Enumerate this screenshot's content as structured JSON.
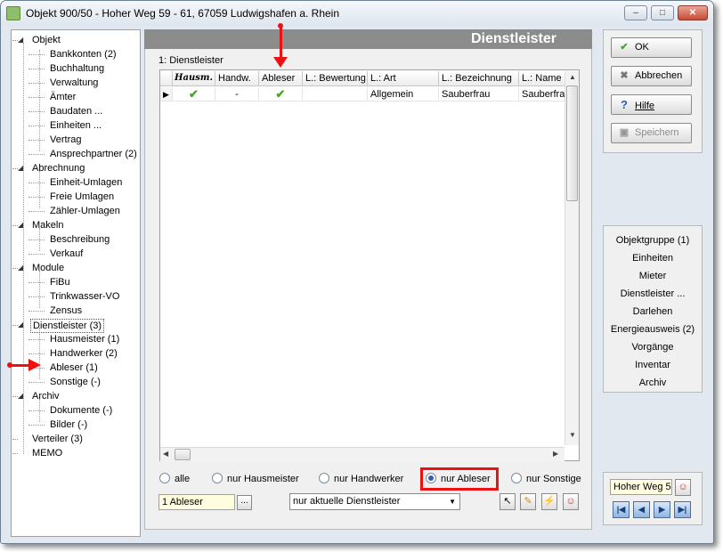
{
  "window": {
    "title": "Objekt 900/50 - Hoher Weg 59 - 61, 67059 Ludwigshafen a. Rhein",
    "min": "‒",
    "max": "□",
    "close": "✕"
  },
  "tree": {
    "objekt": "Objekt",
    "bankkonten": "Bankkonten (2)",
    "buchhaltung": "Buchhaltung",
    "verwaltung": "Verwaltung",
    "aemter": "Ämter",
    "baudaten": "Baudaten ...",
    "einheiten": "Einheiten ...",
    "vertrag": "Vertrag",
    "ansprechpartner": "Ansprechpartner (2)",
    "abrechnung": "Abrechnung",
    "einheit_umlagen": "Einheit-Umlagen",
    "freie_umlagen": "Freie Umlagen",
    "zaehler_umlagen": "Zähler-Umlagen",
    "makeln": "Makeln",
    "beschreibung": "Beschreibung",
    "verkauf": "Verkauf",
    "module": "Module",
    "fibu": "FiBu",
    "trinkwasser": "Trinkwasser-VO",
    "zensus": "Zensus",
    "dienstleister": "Dienstleister (3)",
    "hausmeister": "Hausmeister (1)",
    "handwerker": "Handwerker (2)",
    "ableser": "Ableser (1)",
    "sonstige": "Sonstige (-)",
    "archiv": "Archiv",
    "dokumente": "Dokumente (-)",
    "bilder": "Bilder (-)",
    "verteiler": "Verteiler (3)",
    "memo": "MEMO"
  },
  "main": {
    "header": "Dienstleister",
    "group_label": "1: Dienstleister",
    "columns": [
      "Hausm.",
      "Handw.",
      "Ableser",
      "L.: Bewertung",
      "L.: Art",
      "L.: Bezeichnung",
      "L.: Name"
    ],
    "row": {
      "indicator": "▶",
      "hausm": "✔",
      "handw": "-",
      "ableser": "✔",
      "bewertung": "",
      "art": "Allgemein",
      "bezeichnung": "Sauberfrau",
      "name": "Sauberfrau"
    },
    "filters": {
      "alle": "alle",
      "hausmeister": "nur Hausmeister",
      "handwerker": "nur Handwerker",
      "ableser": "nur Ableser",
      "sonstige": "nur Sonstige",
      "selected": "nur Ableser"
    },
    "count_field": "1 Ableser",
    "dots": "...",
    "combo": "nur aktuelle Dienstleister",
    "combo_arrow": "▼"
  },
  "buttons": {
    "ok": "OK",
    "abbrechen": "Abbrechen",
    "hilfe": "Hilfe",
    "speichern": "Speichern"
  },
  "links": [
    "Objektgruppe (1)",
    "Einheiten",
    "Mieter",
    "Dienstleister ...",
    "Darlehen",
    "Energieausweis (2)",
    "Vorgänge",
    "Inventar",
    "Archiv"
  ],
  "nav": {
    "field": "Hoher Weg 5",
    "first": "|◀",
    "prev": "◀",
    "next": "▶",
    "last": "▶|"
  },
  "colors": {
    "accent_red": "#e11111",
    "header_gray": "#8c8c8c",
    "check_green": "#4ba32e"
  }
}
